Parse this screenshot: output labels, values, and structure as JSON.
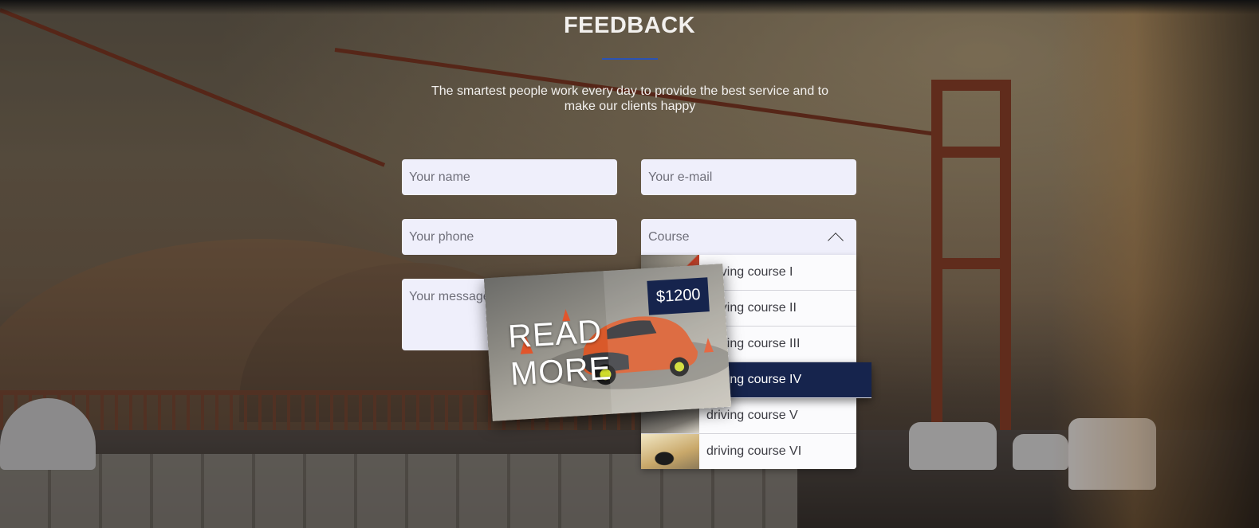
{
  "header": {
    "title": "FEEDBACK",
    "subtitle": "The smartest people work every day to provide the best service and to make our clients happy"
  },
  "form": {
    "name_placeholder": "Your name",
    "email_placeholder": "Your e-mail",
    "phone_placeholder": "Your phone",
    "message_placeholder": "Your message",
    "course_select": {
      "placeholder": "Course",
      "expanded": true,
      "options": [
        {
          "label": "driving course I"
        },
        {
          "label": "driving course II"
        },
        {
          "label": "driving course III"
        },
        {
          "label": "driving course IV"
        },
        {
          "label": "driving course V"
        },
        {
          "label": "driving course VI"
        }
      ],
      "highlighted_index": 3
    }
  },
  "preview_card": {
    "cta": "READ MORE",
    "price": "$1200"
  },
  "colors": {
    "accent": "#2b53b5",
    "highlight": "#16244d",
    "field_bg": "#efeffb"
  }
}
